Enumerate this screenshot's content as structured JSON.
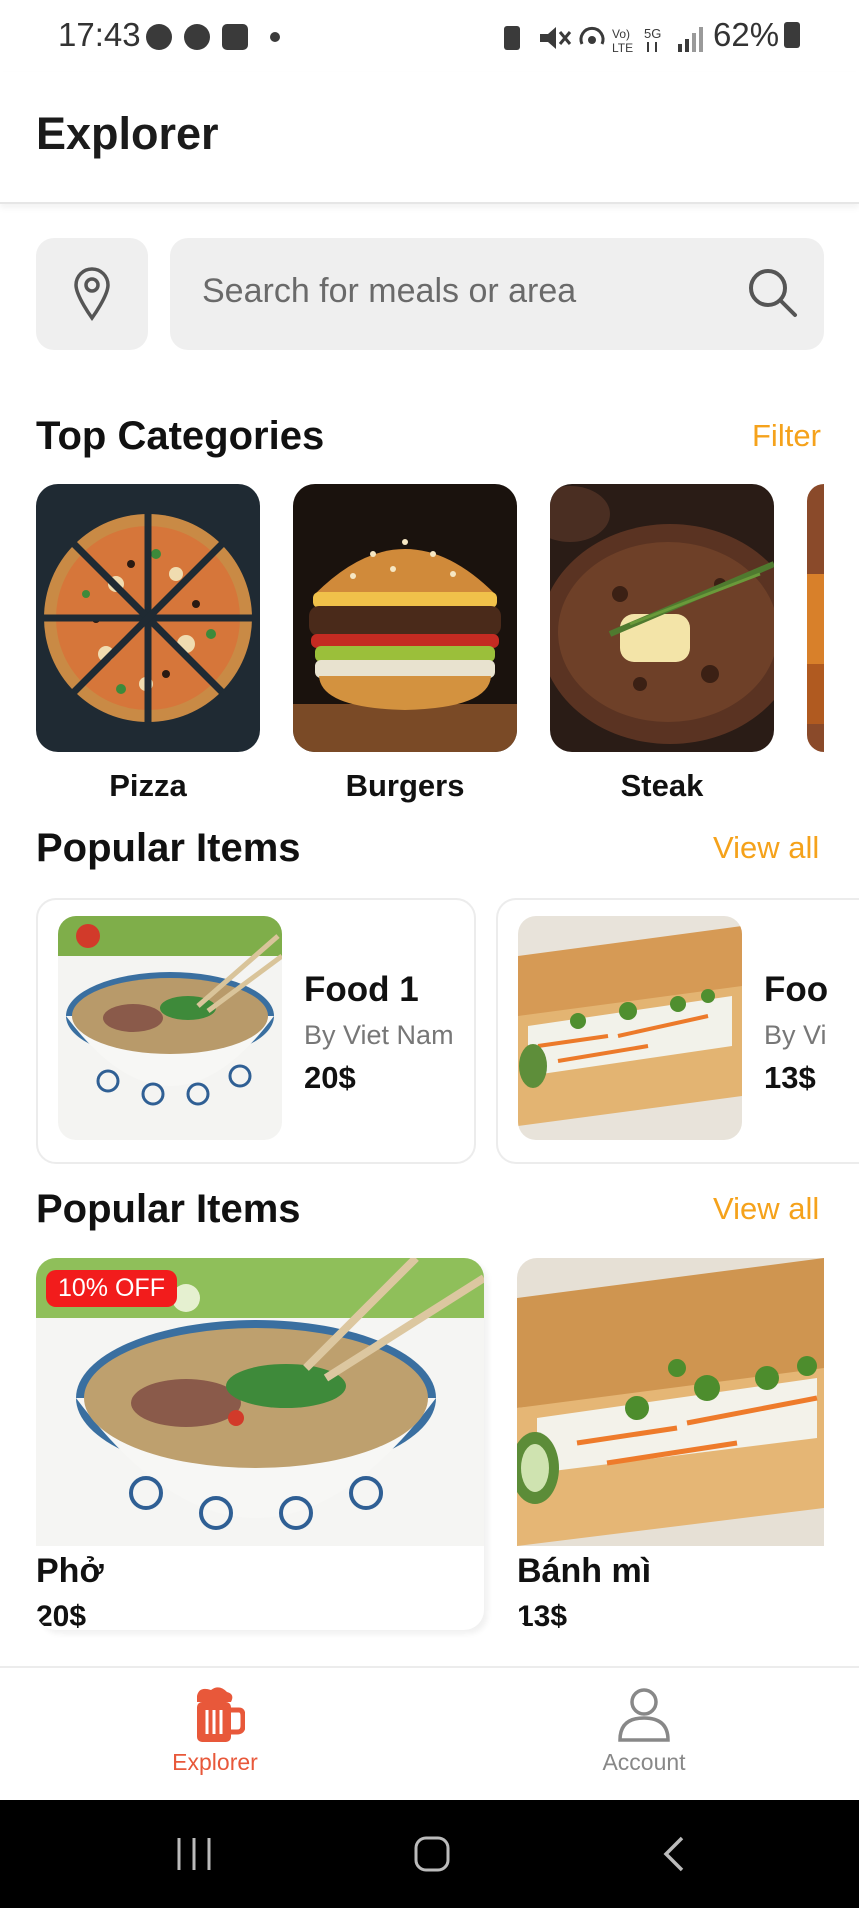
{
  "status_bar": {
    "time": "17:43",
    "battery": "62%",
    "icons": [
      "messenger-icon",
      "messenger-icon",
      "image-icon",
      "dot-icon",
      "battery-saver-icon",
      "mute-icon",
      "hotspot-icon",
      "volte-icon",
      "5g-icon",
      "signal-icon",
      "battery-icon"
    ]
  },
  "header": {
    "title": "Explorer"
  },
  "search": {
    "placeholder": "Search for meals or area",
    "location_icon": "map-pin-icon",
    "search_icon": "search-icon"
  },
  "top_categories": {
    "title": "Top Categories",
    "filter_label": "Filter",
    "items": [
      {
        "label": "Pizza"
      },
      {
        "label": "Burgers"
      },
      {
        "label": "Steak"
      }
    ]
  },
  "popular_items_1": {
    "title": "Popular Items",
    "view_all": "View all",
    "items": [
      {
        "name": "Food 1",
        "by": "By Viet Nam",
        "price": "20$"
      },
      {
        "name": "Foo",
        "by": "By Vi",
        "price": "13$"
      }
    ]
  },
  "popular_items_2": {
    "title": "Popular Items",
    "view_all": "View all",
    "items": [
      {
        "name": "Phở",
        "price": "20$",
        "badge": "10% OFF"
      },
      {
        "name": "Bánh mì",
        "price": "13$"
      }
    ]
  },
  "bottom_nav": {
    "items": [
      {
        "label": "Explorer",
        "icon": "beer-mug-icon",
        "active": true
      },
      {
        "label": "Account",
        "icon": "user-icon",
        "active": false
      }
    ],
    "active_color": "#e8583a",
    "inactive_color": "#888888"
  },
  "system_nav": {
    "icons": [
      "recent-apps-icon",
      "home-icon",
      "back-icon"
    ]
  },
  "colors": {
    "accent": "#f5a21b",
    "badge": "#f21c1c"
  }
}
